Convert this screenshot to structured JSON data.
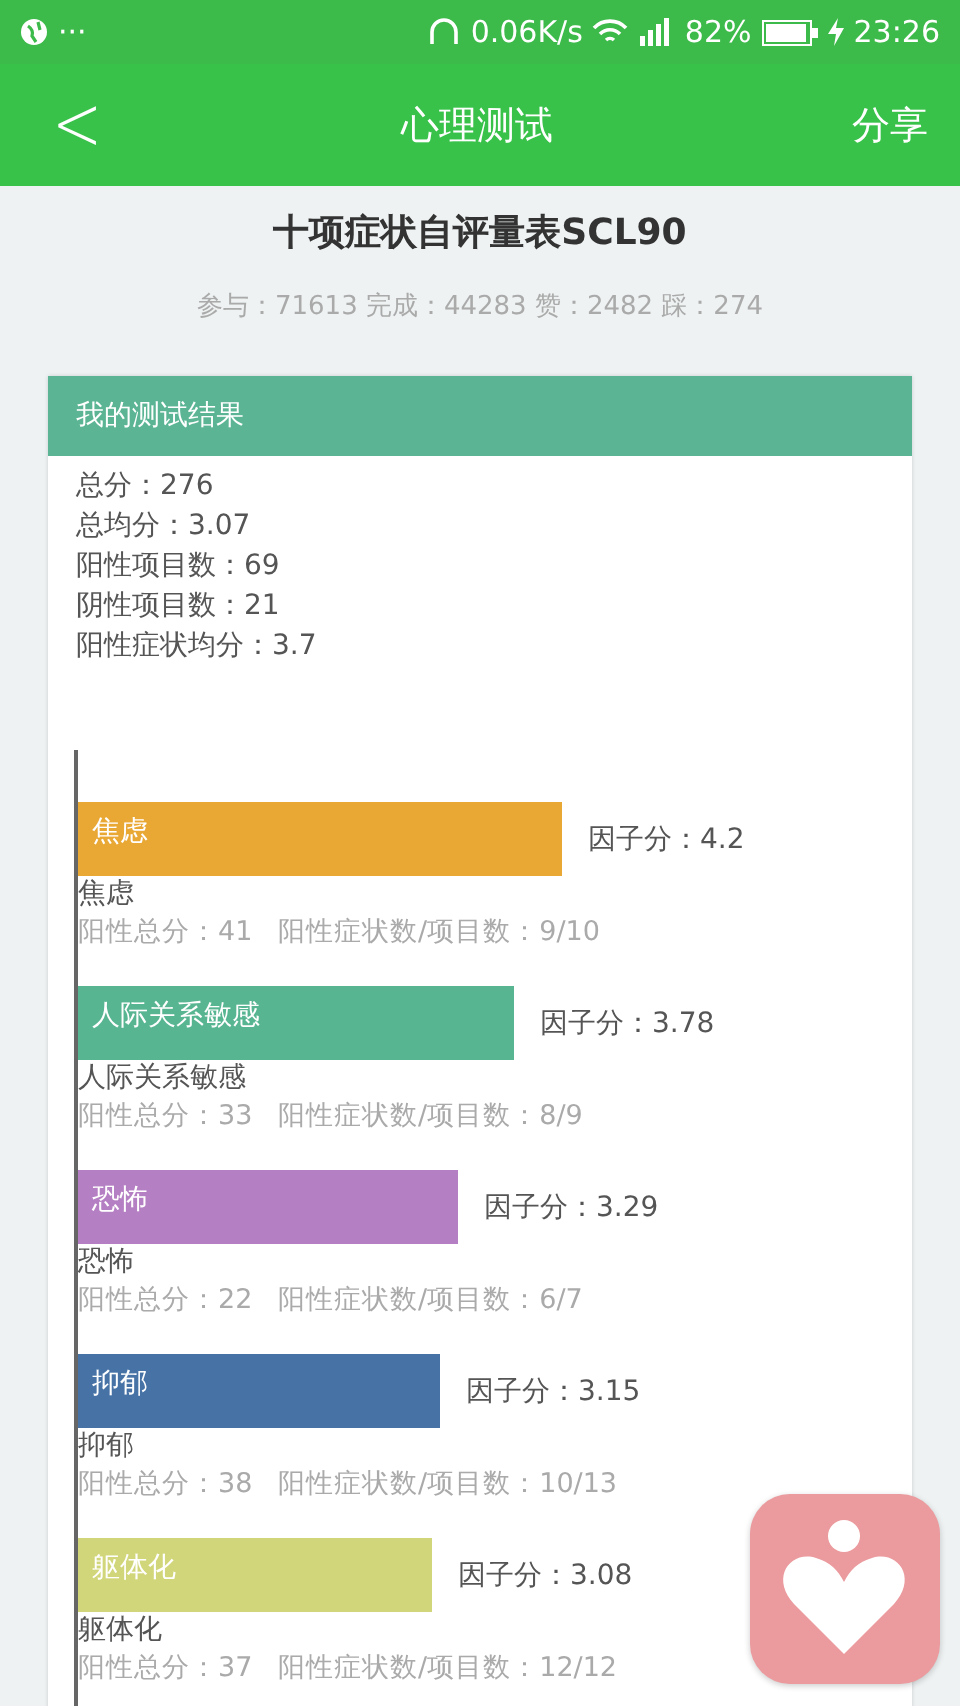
{
  "status_bar": {
    "dots": "···",
    "speed": "0.06K/s",
    "battery": "82%",
    "time": "23:26"
  },
  "header": {
    "back": "<",
    "title": "心理测试",
    "share": "分享"
  },
  "test": {
    "title": "十项症状自评量表SCL90",
    "stats": "参与：71613 完成：44283 赞：2482 踩：274"
  },
  "result_card": {
    "title": "我的测试结果",
    "summary": [
      "总分：276",
      "总均分：3.07",
      "阳性项目数：69",
      "阴性项目数：21",
      "阳性症状均分：3.7"
    ],
    "chart_data": {
      "type": "bar",
      "orientation": "horizontal",
      "categories": [
        "焦虑",
        "人际关系敏感",
        "恐怖",
        "抑郁",
        "躯体化"
      ],
      "values": [
        4.2,
        3.78,
        3.29,
        3.15,
        3.08
      ],
      "value_labels": [
        "因子分：4.2",
        "因子分：3.78",
        "因子分：3.29",
        "因子分：3.15",
        "因子分：3.08"
      ]
    },
    "factors": [
      {
        "color": "#e9a733",
        "label": "焦虑",
        "positive_total": "阳性总分：41",
        "ratio": "阳性症状数/项目数：9/10"
      },
      {
        "color": "#58b592",
        "label": "人际关系敏感",
        "positive_total": "阳性总分：33",
        "ratio": "阳性症状数/项目数：8/9"
      },
      {
        "color": "#b57fc3",
        "label": "恐怖",
        "positive_total": "阳性总分：22",
        "ratio": "阳性症状数/项目数：6/7"
      },
      {
        "color": "#4672a6",
        "label": "抑郁",
        "positive_total": "阳性总分：38",
        "ratio": "阳性症状数/项目数：10/13"
      },
      {
        "color": "#d2d67a",
        "label": "躯体化",
        "positive_total": "阳性总分：37",
        "ratio": "阳性症状数/项目数：12/12"
      }
    ]
  }
}
